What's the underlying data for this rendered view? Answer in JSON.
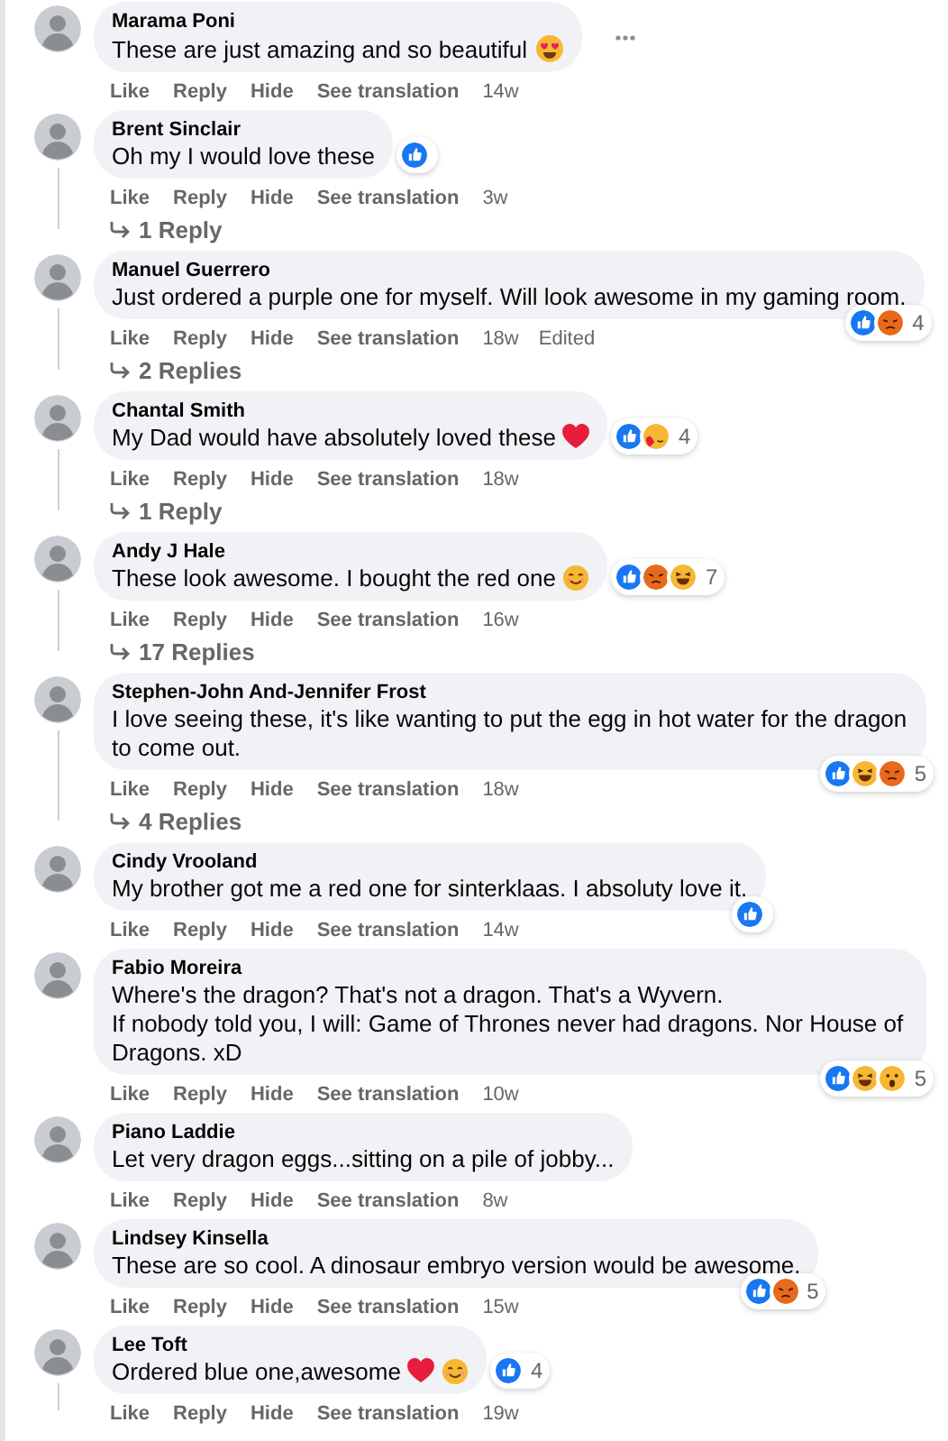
{
  "comments": [
    {
      "name": "Marama Poni",
      "text": "These are just amazing and so beautiful",
      "emoji": [
        {
          "kind": "heart_eyes"
        }
      ],
      "actions": [
        "Like",
        "Reply",
        "Hide",
        "See translation"
      ],
      "time": "14w",
      "more_menu": true
    },
    {
      "name": "Brent Sinclair",
      "text": "Oh my I would love these",
      "reactions": {
        "types": [
          {
            "kind": "like"
          }
        ]
      },
      "actions": [
        "Like",
        "Reply",
        "Hide",
        "See translation"
      ],
      "time": "3w",
      "replies": "1 Reply"
    },
    {
      "name": "Manuel Guerrero",
      "text": "Just ordered a purple one for myself. Will look awesome in my gaming room.",
      "reactions": {
        "types": [
          {
            "kind": "like"
          },
          {
            "kind": "angry"
          }
        ],
        "count": "4"
      },
      "actions": [
        "Like",
        "Reply",
        "Hide",
        "See translation"
      ],
      "time": "18w",
      "edited": "Edited",
      "replies": "2 Replies"
    },
    {
      "name": "Chantal Smith",
      "text": "My Dad would have absolutely loved these",
      "emoji": [
        {
          "kind": "heart"
        }
      ],
      "reactions": {
        "types": [
          {
            "kind": "like"
          },
          {
            "kind": "care"
          }
        ],
        "count": "4"
      },
      "actions": [
        "Like",
        "Reply",
        "Hide",
        "See translation"
      ],
      "time": "18w",
      "replies": "1 Reply"
    },
    {
      "name": "Andy J Hale",
      "text": "These look awesome. I bought the red one",
      "emoji": [
        {
          "kind": "smile"
        }
      ],
      "reactions": {
        "types": [
          {
            "kind": "like"
          },
          {
            "kind": "angry"
          },
          {
            "kind": "haha"
          }
        ],
        "count": "7"
      },
      "actions": [
        "Like",
        "Reply",
        "Hide",
        "See translation"
      ],
      "time": "16w",
      "replies": "17 Replies"
    },
    {
      "name": "Stephen-John And-Jennifer Frost",
      "text": "I love seeing these, it's like wanting to put the egg in hot water for the dragon to come out.",
      "reactions": {
        "types": [
          {
            "kind": "like"
          },
          {
            "kind": "haha"
          },
          {
            "kind": "angry"
          }
        ],
        "count": "5"
      },
      "actions": [
        "Like",
        "Reply",
        "Hide",
        "See translation"
      ],
      "time": "18w",
      "replies": "4 Replies"
    },
    {
      "name": "Cindy Vrooland",
      "text": "My brother got me a red one for sinterklaas. I absoluty love it.",
      "reactions": {
        "types": [
          {
            "kind": "like"
          }
        ]
      },
      "actions": [
        "Like",
        "Reply",
        "Hide",
        "See translation"
      ],
      "time": "14w"
    },
    {
      "name": "Fabio Moreira",
      "text": "Where's the dragon? That's not a dragon. That's a Wyvern.\nIf nobody told you, I will: Game of Thrones never had dragons. Nor House of Dragons. xD",
      "reactions": {
        "types": [
          {
            "kind": "like"
          },
          {
            "kind": "haha"
          },
          {
            "kind": "wow"
          }
        ],
        "count": "5"
      },
      "actions": [
        "Like",
        "Reply",
        "Hide",
        "See translation"
      ],
      "time": "10w"
    },
    {
      "name": "Piano Laddie",
      "text": "Let very dragon eggs...sitting on a pile of jobby...",
      "actions": [
        "Like",
        "Reply",
        "Hide",
        "See translation"
      ],
      "time": "8w"
    },
    {
      "name": "Lindsey Kinsella",
      "text": "These are so cool. A dinosaur embryo version would be awesome.",
      "reactions": {
        "types": [
          {
            "kind": "like"
          },
          {
            "kind": "angry"
          }
        ],
        "count": "5"
      },
      "actions": [
        "Like",
        "Reply",
        "Hide",
        "See translation"
      ],
      "time": "15w"
    },
    {
      "name": "Lee Toft",
      "text": "Ordered blue one,awesome",
      "emoji": [
        {
          "kind": "heart"
        },
        {
          "kind": "smile"
        }
      ],
      "reactions": {
        "types": [
          {
            "kind": "like"
          }
        ],
        "count": "4"
      },
      "actions": [
        "Like",
        "Reply",
        "Hide",
        "See translation"
      ],
      "time": "19w",
      "thread": true
    }
  ]
}
